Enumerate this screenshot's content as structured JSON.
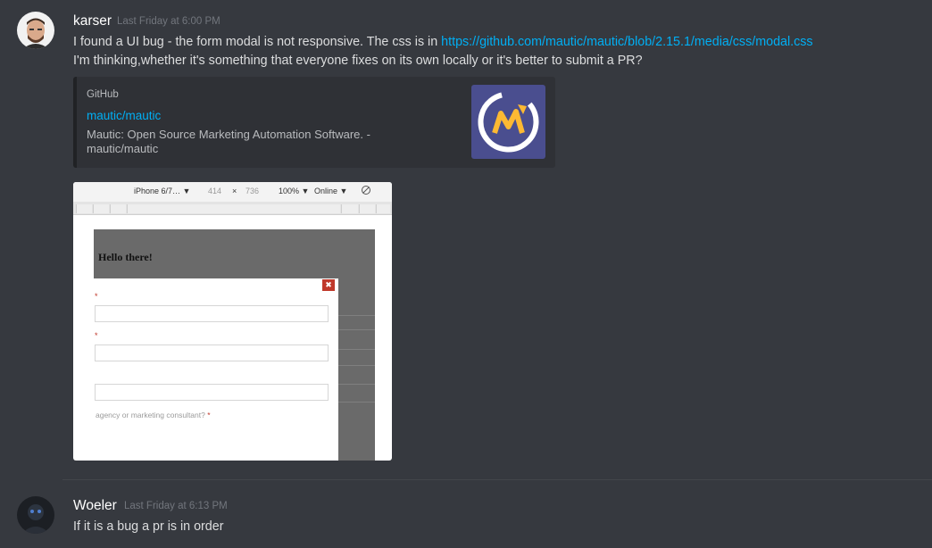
{
  "messages": [
    {
      "username": "karser",
      "timestamp": "Last Friday at 6:00 PM",
      "line1_text": "I found a UI bug - the form modal is not responsive. The css is in ",
      "line1_link": "https://github.com/mautic/mautic/blob/2.15.1/media/css/modal.css",
      "line2": "I'm thinking,whether it's something that everyone fixes on its own locally or it's better to submit a PR?",
      "embed": {
        "provider": "GitHub",
        "title": "mautic/mautic",
        "description": "Mautic: Open Source Marketing Automation Software. - mautic/mautic"
      },
      "attachment": {
        "device": "iPhone 6/7… ▼",
        "width": "414",
        "times": "×",
        "height": "736",
        "zoom": "100% ▼",
        "network": "Online ▼",
        "heading": "Hello there!",
        "close": "✖",
        "question": "agency or marketing consultant?",
        "required_mark": "*"
      }
    },
    {
      "username": "Woeler",
      "timestamp": "Last Friday at 6:13 PM",
      "text": "If it is a bug a pr is in order"
    }
  ],
  "colors": {
    "background": "#36393f",
    "link": "#00aff4",
    "mautic_logo_bg": "#4a4e8f",
    "mautic_logo_accent": "#fdb933"
  }
}
